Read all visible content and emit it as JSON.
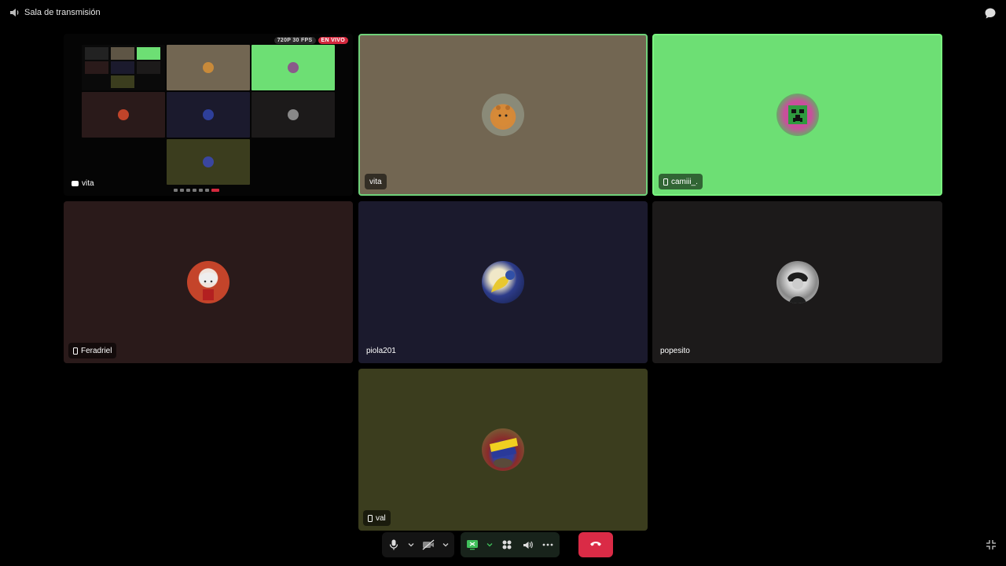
{
  "header": {
    "title": "Sala de transmisión",
    "speaker_icon": "speaker-icon",
    "chat_icon": "chat-bubble-icon"
  },
  "stream": {
    "presenter": "vita",
    "resolution_badge": "720P 30 FPS",
    "live_badge": "EN VIVO"
  },
  "tiles": [
    {
      "id": "vita",
      "name": "vita",
      "bg": "#726652",
      "speaking": true,
      "device": "none"
    },
    {
      "id": "camiii",
      "name": "camiii_.",
      "bg": "#6ddf74",
      "speaking": true,
      "device": "mobile"
    },
    {
      "id": "feradriel",
      "name": "Feradriel",
      "bg": "#2a1a1a",
      "device": "mobile"
    },
    {
      "id": "piola",
      "name": "piola201",
      "bg": "#1b1a2d",
      "device": "none"
    },
    {
      "id": "popesito",
      "name": "popesito",
      "bg": "#1c1a1a",
      "device": "none"
    },
    {
      "id": "val",
      "name": "val",
      "bg": "#3b3d1e",
      "device": "mobile"
    }
  ],
  "controls": {
    "mic": "microphone-icon",
    "camera": "camera-off-icon",
    "screenshare": "screen-share-icon",
    "activities": "activities-icon",
    "soundboard": "soundboard-icon",
    "more": "more-icon",
    "disconnect": "disconnect-icon",
    "exit_fullscreen": "exit-fullscreen-icon"
  },
  "colors": {
    "speaking_ring": "#6fd17a",
    "live": "#d3283d",
    "disconnect": "#da2b46"
  }
}
